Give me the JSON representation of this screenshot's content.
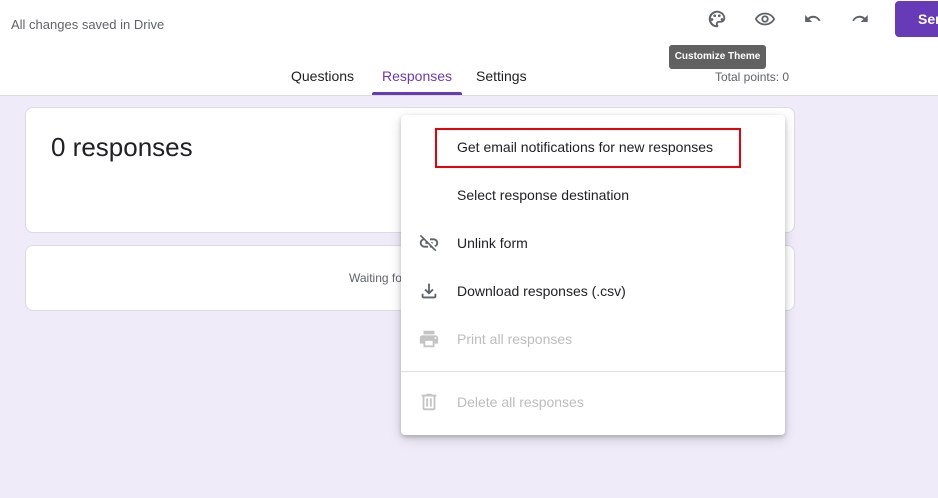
{
  "header": {
    "saved_status": "All changes saved in Drive",
    "send_label": "Ser",
    "tooltip": "Customize Theme",
    "total_points": "Total points: 0",
    "icons": [
      "palette-icon",
      "eye-icon",
      "undo-icon",
      "redo-icon"
    ]
  },
  "tabs": [
    {
      "label": "Questions",
      "active": false
    },
    {
      "label": "Responses",
      "active": true
    },
    {
      "label": "Settings",
      "active": false
    }
  ],
  "summary": {
    "count_label": "0 responses",
    "waiting_text": "Waiting fo"
  },
  "menu": {
    "items": [
      {
        "label": "Get email notifications for new responses",
        "icon": "",
        "disabled": false
      },
      {
        "label": "Select response destination",
        "icon": "",
        "disabled": false
      },
      {
        "label": "Unlink form",
        "icon": "unlink-icon",
        "disabled": false
      },
      {
        "label": "Download responses (.csv)",
        "icon": "download-icon",
        "disabled": false
      },
      {
        "label": "Print all responses",
        "icon": "print-icon",
        "disabled": true
      },
      {
        "label": "Delete all responses",
        "icon": "trash-icon",
        "disabled": true
      }
    ]
  },
  "colors": {
    "accent": "#673ab7",
    "background": "#efebf8",
    "highlight": "#e8000b"
  }
}
